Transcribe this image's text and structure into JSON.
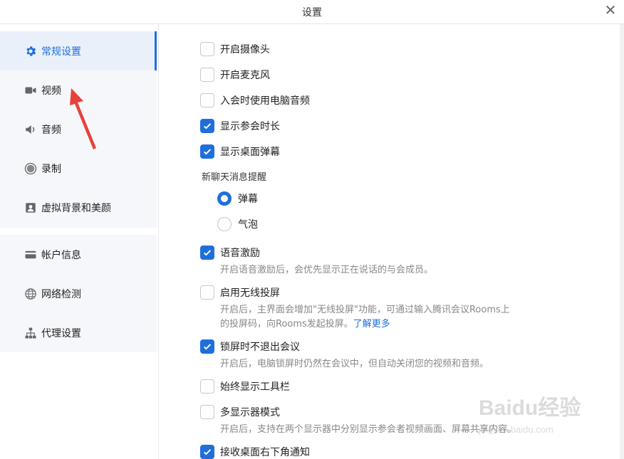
{
  "window": {
    "title": "设置"
  },
  "sidebar": {
    "items": [
      {
        "label": "常规设置",
        "icon": "gear-icon",
        "active": true
      },
      {
        "label": "视频",
        "icon": "video-camera-icon"
      },
      {
        "label": "音频",
        "icon": "speaker-icon"
      },
      {
        "label": "录制",
        "icon": "record-icon"
      },
      {
        "label": "虚拟背景和美颜",
        "icon": "portrait-icon"
      },
      {
        "label": "帐户信息",
        "icon": "card-icon"
      },
      {
        "label": "网络检测",
        "icon": "globe-icon"
      },
      {
        "label": "代理设置",
        "icon": "network-icon"
      }
    ]
  },
  "settings": {
    "camera": {
      "label": "开启摄像头",
      "checked": false
    },
    "mic": {
      "label": "开启麦克风",
      "checked": false
    },
    "pc_audio": {
      "label": "入会时使用电脑音频",
      "checked": false
    },
    "show_duration": {
      "label": "显示参会时长",
      "checked": true
    },
    "desktop_barrage": {
      "label": "显示桌面弹幕",
      "checked": true
    },
    "chat_reminder": {
      "title": "新聊天消息提醒",
      "options": [
        {
          "label": "弹幕",
          "selected": true
        },
        {
          "label": "气泡",
          "selected": false
        }
      ]
    },
    "voice_motivation": {
      "label": "语音激励",
      "checked": true,
      "desc": "开启语音激励后，会优先显示正在说话的与会成员。"
    },
    "wireless_share": {
      "label": "启用无线投屏",
      "checked": false,
      "desc1": "开启后，主界面会增加\"无线投屏\"功能，可通过输入腾讯会议Rooms上",
      "desc2": "的投屏码，向Rooms发起投屏。",
      "link": "了解更多"
    },
    "lock_screen": {
      "label": "锁屏时不退出会议",
      "checked": true,
      "desc": "开启后，电脑锁屏时仍然在会议中，但自动关闭您的视频和音频。"
    },
    "toolbar": {
      "label": "始终显示工具栏",
      "checked": false
    },
    "multi_display": {
      "label": "多显示器模式",
      "checked": false,
      "desc": "开启后，支持在两个显示器中分别显示参会者视频画面、屏幕共享内容。"
    },
    "notify": {
      "label": "接收桌面右下角通知",
      "checked": true
    }
  },
  "watermark": {
    "text1": "Baidu经验",
    "text2": "jingyan.baidu.com"
  },
  "colors": {
    "accent": "#1f6fdb",
    "annotation_arrow": "#e8413b"
  }
}
